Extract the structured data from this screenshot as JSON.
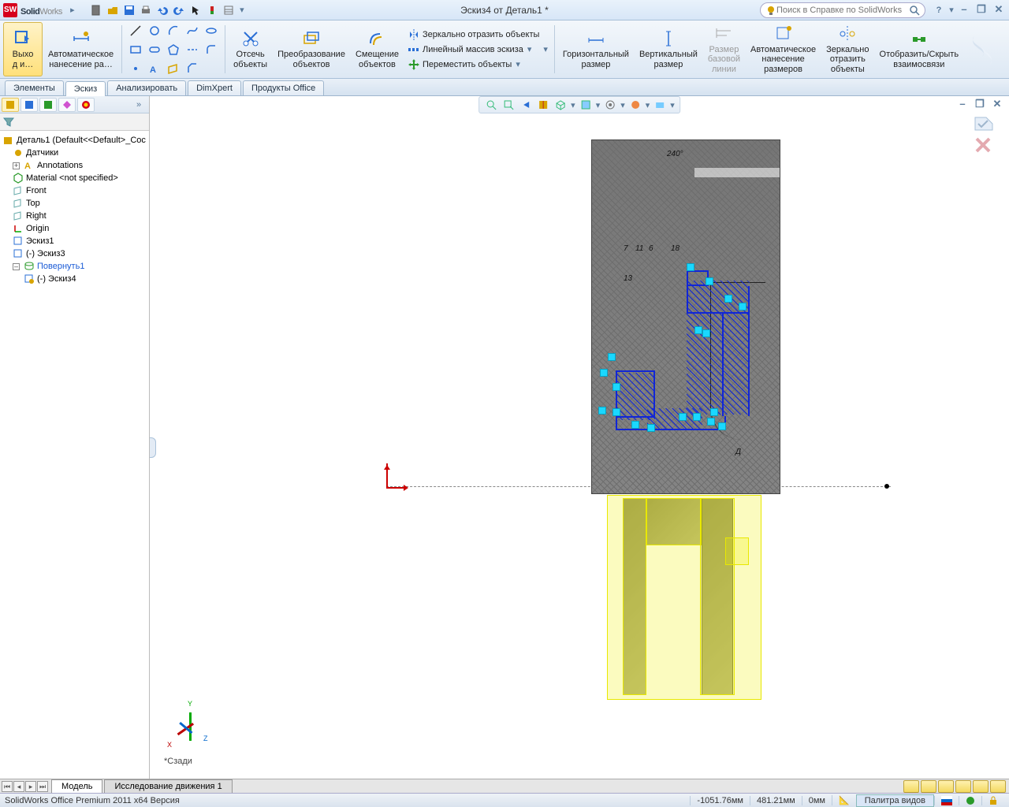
{
  "brand_bold": "Solid",
  "brand_light": "Works",
  "doc_title": "Эскиз4 от Деталь1 *",
  "search_placeholder": "Поиск в Справке по SolidWorks",
  "ribbon": {
    "exit_sketch": "Выхо\nд и…",
    "auto_dim": "Автоматическое\nнанесение ра…",
    "trim": "Отсечь\nобъекты",
    "convert": "Преобразование\nобъектов",
    "offset": "Смещение\nобъектов",
    "mirror": "Зеркально отразить объекты",
    "linear": "Линейный массив эскиза",
    "move": "Переместить объекты",
    "hdim": "Горизонтальный\nразмер",
    "vdim": "Вертикальный\nразмер",
    "baseline": "Размер\nбазовой\nлинии",
    "auto_size": "Автоматическое\nнанесение\nразмеров",
    "mirror2": "Зеркально\nотразить\nобъекты",
    "showhide": "Отобразить/Скрыть\nвзаимосвязи"
  },
  "tabs": {
    "t1": "Элементы",
    "t2": "Эскиз",
    "t3": "Анализировать",
    "t4": "DimXpert",
    "t5": "Продукты Office"
  },
  "tree": {
    "root": "Деталь1 (Default<<Default>_Сос",
    "sensors": "Датчики",
    "annotations": "Annotations",
    "material": "Material <not specified>",
    "front": "Front",
    "top": "Top",
    "right": "Right",
    "origin": "Origin",
    "sk1": "Эскиз1",
    "sk3": "(-) Эскиз3",
    "rev": "Повернуть1",
    "sk4": "(-) Эскиз4"
  },
  "view_label": "*Сзади",
  "doc_tabs": {
    "model": "Модель",
    "motion": "Исследование движения 1"
  },
  "footer": "SolidWorks Office Premium 2011 x64 Версия",
  "coords": {
    "x": "-1051.76мм",
    "y": "481.21мм",
    "z": "0мм"
  },
  "palette": "Палитра видов",
  "sk": {
    "b40": "240°",
    "n7": "7",
    "n11": "11",
    "n6": "6",
    "n18": "18",
    "n13": "13",
    "D": "Д"
  }
}
